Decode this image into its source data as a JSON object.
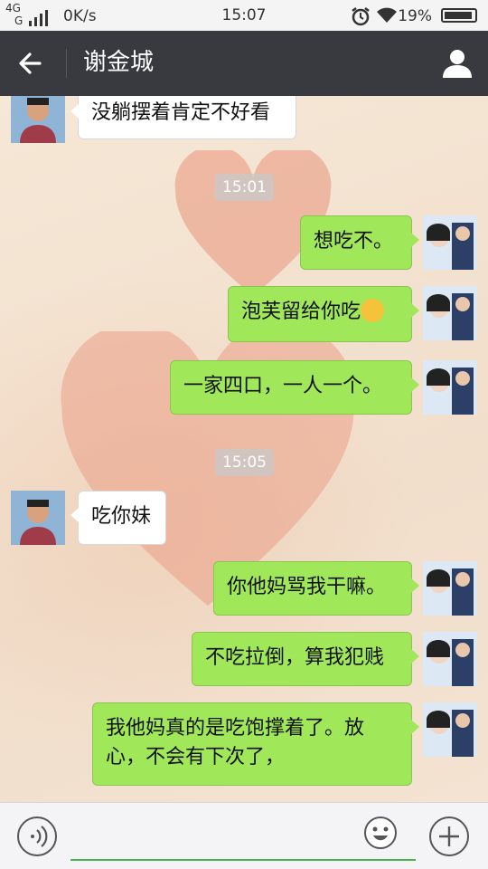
{
  "status_bar": {
    "network_top": "4G",
    "network_bottom": "G",
    "speed": "0K/s",
    "time": "15:07",
    "battery": "19%",
    "icons": [
      "signal-icon",
      "alarm-icon",
      "wifi-icon",
      "battery-icon"
    ]
  },
  "header": {
    "title": "谢金城",
    "back_icon": "arrow-left-icon",
    "profile_icon": "person-icon"
  },
  "chat": {
    "timestamps": [
      "15:01",
      "15:05"
    ],
    "messages": [
      {
        "side": "in",
        "text": "没躺摆着肯定不好看"
      },
      {
        "side": "out",
        "text": "想吃不。"
      },
      {
        "side": "out",
        "text": "泡芙留给你吃",
        "emoji": "heart-eyes-emoji"
      },
      {
        "side": "out",
        "text": "一家四口，一人一个。"
      },
      {
        "side": "in",
        "text": "吃你妹"
      },
      {
        "side": "out",
        "text": "你他妈骂我干嘛。"
      },
      {
        "side": "out",
        "text": "不吃拉倒，算我犯贱"
      },
      {
        "side": "out",
        "text": "我他妈真的是吃饱撑着了。放心，不会有下次了，"
      }
    ]
  },
  "input_bar": {
    "value": "",
    "voice_icon": "voice-icon",
    "emoji_icon": "smiley-icon",
    "plus_icon": "plus-icon"
  }
}
